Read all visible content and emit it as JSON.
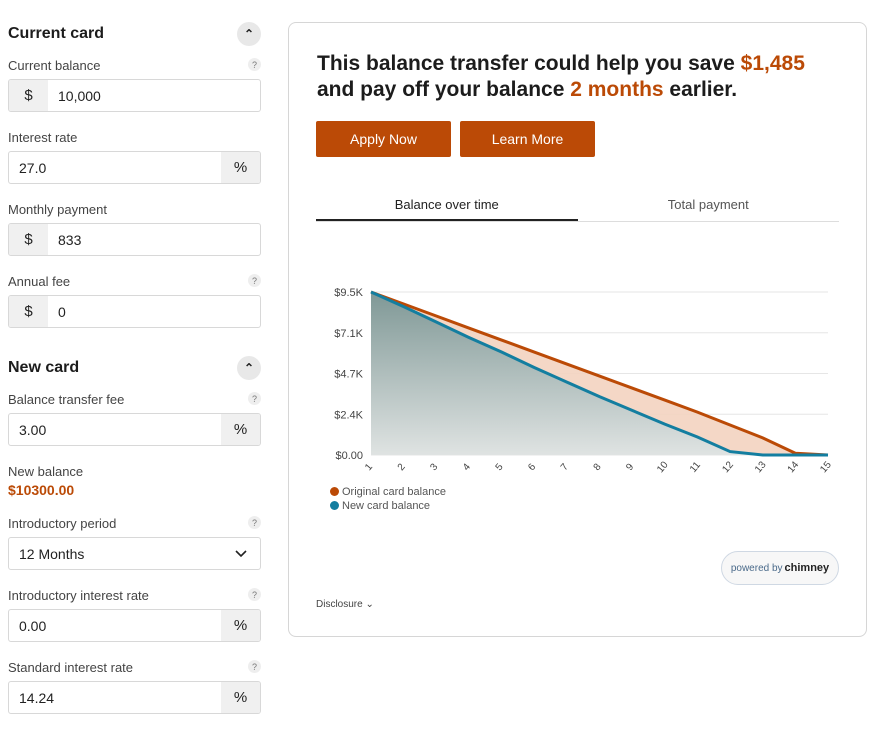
{
  "current_card": {
    "title": "Current card",
    "fields": [
      {
        "label": "Current balance",
        "prefix": "$",
        "value": "10,000",
        "help": "?"
      },
      {
        "label": "Interest rate",
        "value": "27.0",
        "suffix": "%"
      },
      {
        "label": "Monthly payment",
        "prefix": "$",
        "value": "833"
      },
      {
        "label": "Annual fee",
        "prefix": "$",
        "value": "0",
        "help": "?"
      }
    ]
  },
  "new_card": {
    "title": "New card",
    "transfer_fee": {
      "label": "Balance transfer fee",
      "value": "3.00",
      "suffix": "%",
      "help": "?"
    },
    "new_balance": {
      "label": "New balance",
      "value": "$10300.00"
    },
    "intro_period": {
      "label": "Introductory period",
      "value": "12 Months",
      "help": "?"
    },
    "intro_rate": {
      "label": "Introductory interest rate",
      "value": "0.00",
      "suffix": "%",
      "help": "?"
    },
    "std_rate": {
      "label": "Standard interest rate",
      "value": "14.24",
      "suffix": "%",
      "help": "?"
    }
  },
  "result": {
    "line1": "This balance transfer could help you save ",
    "savings": "$1,485",
    "line2": "and pay off your balance ",
    "months": "2 months",
    "line3": " earlier.",
    "apply": "Apply Now",
    "learn": "Learn More",
    "tabs": [
      "Balance over time",
      "Total payment"
    ],
    "powered_by": "powered by",
    "brand": "chimney",
    "disclosure": "Disclosure"
  },
  "colors": {
    "accent": "#bb4a06",
    "original": "#bb4a06",
    "new": "#137ea0"
  },
  "chart_data": {
    "type": "area",
    "x": [
      1,
      2,
      3,
      4,
      5,
      6,
      7,
      8,
      9,
      10,
      11,
      12,
      13,
      14,
      15
    ],
    "yticks": [
      "$0.00",
      "$2.4K",
      "$4.7K",
      "$7.1K",
      "$9.5K"
    ],
    "ytick_values": [
      0,
      2375,
      4750,
      7125,
      9500
    ],
    "ylim": [
      0,
      9500
    ],
    "grid": true,
    "legend": "bottom-left",
    "series": [
      {
        "name": "Original card balance",
        "values": [
          9500,
          8800,
          8100,
          7400,
          6700,
          6000,
          5300,
          4600,
          3900,
          3200,
          2500,
          1750,
          1000,
          100,
          0
        ]
      },
      {
        "name": "New card balance",
        "values": [
          9500,
          8650,
          7750,
          6850,
          6000,
          5100,
          4250,
          3400,
          2600,
          1800,
          1050,
          200,
          0,
          0,
          0
        ]
      }
    ]
  }
}
